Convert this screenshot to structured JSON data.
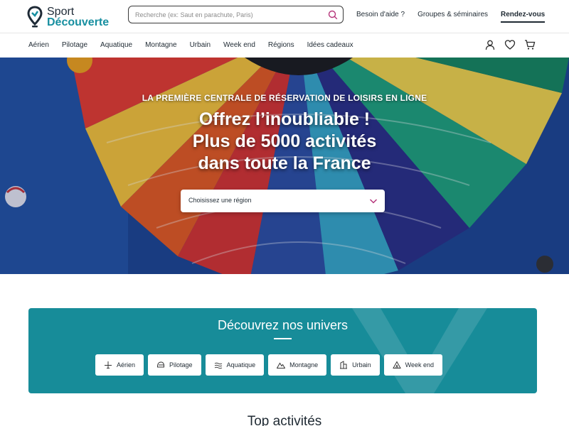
{
  "header": {
    "logo": {
      "line1": "Sport",
      "line2": "Découverte"
    },
    "search": {
      "placeholder": "Recherche (ex: Saut en parachute, Paris)"
    },
    "links": [
      "Besoin d'aide ?",
      "Groupes & séminaires"
    ],
    "cta": "Rendez-vous"
  },
  "nav": {
    "items": [
      "Aérien",
      "Pilotage",
      "Aquatique",
      "Montagne",
      "Urbain",
      "Week end",
      "Régions",
      "Idées cadeaux"
    ],
    "icons": [
      "user-icon",
      "heart-icon",
      "cart-icon"
    ]
  },
  "hero": {
    "kicker": "LA PREMIÈRE CENTRALE DE RÉSERVATION DE LOISIRS EN LIGNE",
    "title_lines": [
      "Offrez l’inoubliable !",
      "Plus de 5000 activités",
      "dans toute la France"
    ],
    "region_select": {
      "label": "Choisissez une région"
    }
  },
  "univers": {
    "title": "Découvrez nos univers",
    "chips": [
      {
        "label": "Aérien",
        "icon": "plane-icon"
      },
      {
        "label": "Pilotage",
        "icon": "helmet-icon"
      },
      {
        "label": "Aquatique",
        "icon": "waves-icon"
      },
      {
        "label": "Montagne",
        "icon": "mountain-icon"
      },
      {
        "label": "Urbain",
        "icon": "building-icon"
      },
      {
        "label": "Week end",
        "icon": "tent-icon"
      }
    ]
  },
  "section_title": "Top activités",
  "colors": {
    "brand_teal": "#178c99",
    "logo_teal": "#178fa0",
    "text_dark": "#1f2a33",
    "accent_pink": "#b5357a"
  }
}
